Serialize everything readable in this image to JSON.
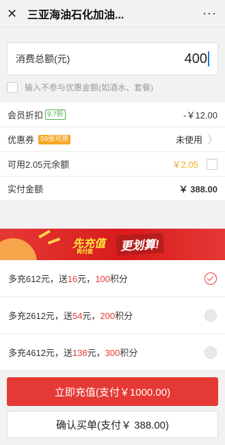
{
  "header": {
    "title": "三亚海油石化加油...",
    "close_icon": "close-icon",
    "more_icon": "more-icon",
    "more_label": "···"
  },
  "amount": {
    "label": "消费总额(元)",
    "value": "400"
  },
  "exclude": {
    "label": "输入不参与优惠金额(如酒水、套餐)"
  },
  "rows": {
    "member": {
      "label": "会员折扣",
      "badge": "9.7折",
      "value": "-￥12.00"
    },
    "coupon": {
      "label": "优惠券",
      "badge": "59张可用",
      "value": "未使用"
    },
    "balance": {
      "label": "可用2.05元余额",
      "value": "￥2.05"
    },
    "pay": {
      "label": "实付金额",
      "value": "￥ 388.00"
    }
  },
  "banner": {
    "text1": "先充值",
    "text1_sub": "再付款",
    "text2": "更划算!"
  },
  "options": [
    {
      "p1": "多充612元，送",
      "gift": "16",
      "p2": "元，",
      "points": "100",
      "p3": "积分",
      "selected": true
    },
    {
      "p1": "多充2612元，送",
      "gift": "54",
      "p2": "元，",
      "points": "200",
      "p3": "积分",
      "selected": false
    },
    {
      "p1": "多充4612元，送",
      "gift": "138",
      "p2": "元，",
      "points": "300",
      "p3": "积分",
      "selected": false
    }
  ],
  "buttons": {
    "recharge": "立即充值(支付￥1000.00)",
    "confirm": "确认买单(支付￥ 388.00)"
  },
  "colors": {
    "accent_red": "#e53935",
    "accent_orange": "#f5a623",
    "discount_green": "#4caf50"
  }
}
